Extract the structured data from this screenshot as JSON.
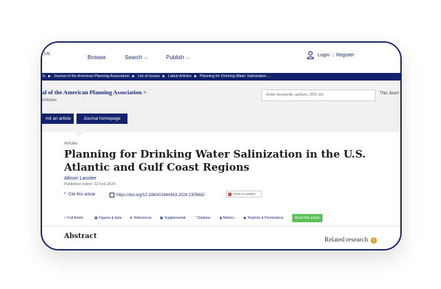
{
  "nav": {
    "logo_fragment": "Us",
    "browse": "Browse",
    "search": "Search",
    "publish": "Publish",
    "login": "Login",
    "separator": "|",
    "register": "Register"
  },
  "breadcrumb": [
    "ls",
    "Journal of the American Planning Association",
    "List of Issues",
    "Latest Articles",
    "Planning for Drinking Water Salinization ..."
  ],
  "journal": {
    "title": "al of the American Planning Association >",
    "subtitle": "Articles",
    "search_placeholder": "Enter keywords, authors, DOI, etc",
    "search_scope": "This Journ",
    "submit_label": "mit an article",
    "homepage_label": "Journal homepage"
  },
  "article": {
    "type": "Articles",
    "title": "Planning for Drinking Water Salinization in the U.S. Atlantic and Gulf Coast Regions",
    "author": "Allison Lassiter",
    "published": "Published online: 22 Feb 2024",
    "cite": "Cite this article",
    "doi": "https://doi.org/10.1080/01944363.2024.2305682",
    "check_updates": "Check for updates"
  },
  "tabs": [
    {
      "label": "Full Article",
      "icon": "document-icon"
    },
    {
      "label": "Figures & data",
      "icon": "chart-icon"
    },
    {
      "label": "References",
      "icon": "references-icon"
    },
    {
      "label": "Supplemental",
      "icon": "supplemental-icon"
    },
    {
      "label": "Citations",
      "icon": "quote-icon"
    },
    {
      "label": "Metrics",
      "icon": "metrics-icon"
    },
    {
      "label": "Reprints & Permissions",
      "icon": "reprints-icon"
    }
  ],
  "read_button": "Read this article",
  "abstract_heading": "Abstract",
  "related": "Related research",
  "colors": {
    "brand": "#13226c",
    "read_button": "#5cbf58",
    "info": "#e49b1c"
  }
}
